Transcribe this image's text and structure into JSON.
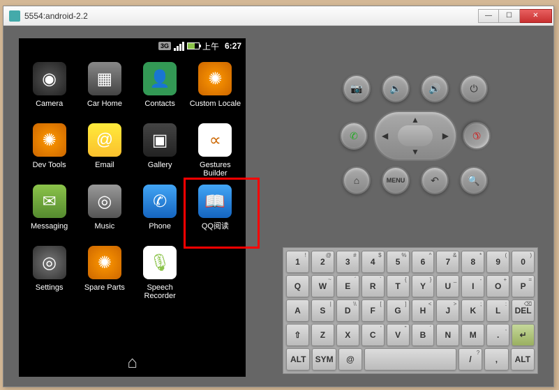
{
  "window": {
    "title": "5554:android-2.2"
  },
  "statusbar": {
    "network": "3G",
    "time_prefix": "上午",
    "time": "6:27"
  },
  "apps": [
    {
      "name": "camera",
      "label": "Camera",
      "glyph": "◉",
      "cls": "ic-camera"
    },
    {
      "name": "car-home",
      "label": "Car Home",
      "glyph": "▦",
      "cls": "ic-carhome"
    },
    {
      "name": "contacts",
      "label": "Contacts",
      "glyph": "👤",
      "cls": "ic-contacts"
    },
    {
      "name": "custom-locale",
      "label": "Custom Locale",
      "glyph": "✺",
      "cls": "ic-custom"
    },
    {
      "name": "dev-tools",
      "label": "Dev Tools",
      "glyph": "✺",
      "cls": "ic-dev"
    },
    {
      "name": "email",
      "label": "Email",
      "glyph": "@",
      "cls": "ic-email"
    },
    {
      "name": "gallery",
      "label": "Gallery",
      "glyph": "▣",
      "cls": "ic-gallery"
    },
    {
      "name": "gestures-builder",
      "label": "Gestures Builder",
      "glyph": "∝",
      "cls": "ic-gestures"
    },
    {
      "name": "messaging",
      "label": "Messaging",
      "glyph": "✉",
      "cls": "ic-msg"
    },
    {
      "name": "music",
      "label": "Music",
      "glyph": "◎",
      "cls": "ic-music"
    },
    {
      "name": "phone",
      "label": "Phone",
      "glyph": "✆",
      "cls": "ic-phone"
    },
    {
      "name": "qq-read",
      "label": "QQ阅读",
      "glyph": "📖",
      "cls": "ic-qq"
    },
    {
      "name": "settings",
      "label": "Settings",
      "glyph": "◎",
      "cls": "ic-settings"
    },
    {
      "name": "spare-parts",
      "label": "Spare Parts",
      "glyph": "✺",
      "cls": "ic-spare"
    },
    {
      "name": "speech-recorder",
      "label": "Speech Recorder",
      "glyph": "🎙",
      "cls": "ic-speech"
    }
  ],
  "highlight": {
    "index": 11
  },
  "controls": {
    "row1": [
      {
        "name": "camera-button",
        "glyph": "📷"
      },
      {
        "name": "volume-down-button",
        "glyph": "🔈"
      },
      {
        "name": "volume-up-button",
        "glyph": "🔊"
      },
      {
        "name": "power-button",
        "glyph": "⏻"
      }
    ],
    "call": {
      "name": "call-button",
      "glyph": "✆",
      "color": "#2a2"
    },
    "end": {
      "name": "end-call-button",
      "glyph": "✆",
      "color": "#c22"
    },
    "row3": [
      {
        "name": "home-button",
        "glyph": "⌂"
      },
      {
        "name": "menu-button",
        "glyph": "MENU",
        "txt": true
      },
      {
        "name": "back-button",
        "glyph": "↶"
      },
      {
        "name": "search-button",
        "glyph": "🔍"
      }
    ]
  },
  "keyboard": {
    "r1": [
      {
        "m": "1",
        "s": "!"
      },
      {
        "m": "2",
        "s": "@"
      },
      {
        "m": "3",
        "s": "#"
      },
      {
        "m": "4",
        "s": "$"
      },
      {
        "m": "5",
        "s": "%"
      },
      {
        "m": "6",
        "s": "^"
      },
      {
        "m": "7",
        "s": "&"
      },
      {
        "m": "8",
        "s": "*"
      },
      {
        "m": "9",
        "s": "("
      },
      {
        "m": "0",
        "s": ")"
      }
    ],
    "r2": [
      {
        "m": "Q"
      },
      {
        "m": "W",
        "s": "~"
      },
      {
        "m": "E",
        "s": "´"
      },
      {
        "m": "R",
        "s": "`"
      },
      {
        "m": "T",
        "s": "{"
      },
      {
        "m": "Y",
        "s": "}"
      },
      {
        "m": "U",
        "s": "_"
      },
      {
        "m": "I",
        "s": "-"
      },
      {
        "m": "O",
        "s": "+"
      },
      {
        "m": "P",
        "s": "="
      }
    ],
    "r3": [
      {
        "m": "A"
      },
      {
        "m": "S",
        "s": "|"
      },
      {
        "m": "D",
        "s": "\\\\"
      },
      {
        "m": "F",
        "s": "["
      },
      {
        "m": "G",
        "s": "]"
      },
      {
        "m": "H",
        "s": "<"
      },
      {
        "m": "J",
        "s": ">"
      },
      {
        "m": "K",
        "s": ";"
      },
      {
        "m": "L",
        "s": ":"
      },
      {
        "m": "DEL",
        "s": "⌫",
        "name": "delete"
      }
    ],
    "r4": [
      {
        "m": "⇧",
        "name": "shift"
      },
      {
        "m": "Z"
      },
      {
        "m": "X"
      },
      {
        "m": "C",
        "s": "'"
      },
      {
        "m": "V",
        "s": "\""
      },
      {
        "m": "B",
        "s": "´"
      },
      {
        "m": "N"
      },
      {
        "m": "M"
      },
      {
        "m": ".",
        "s": ","
      },
      {
        "m": "↵",
        "name": "enter",
        "cls": "enter"
      }
    ],
    "r5": [
      {
        "m": "ALT",
        "name": "alt-left",
        "cls": "alt"
      },
      {
        "m": "SYM",
        "name": "sym",
        "cls": "alt"
      },
      {
        "m": "@",
        "name": "at"
      },
      {
        "m": " ",
        "name": "space",
        "cls": "space"
      },
      {
        "m": "/",
        "s": "?",
        "name": "slash"
      },
      {
        "m": ",",
        "name": "comma"
      },
      {
        "m": "ALT",
        "name": "alt-right",
        "cls": "alt"
      }
    ]
  }
}
